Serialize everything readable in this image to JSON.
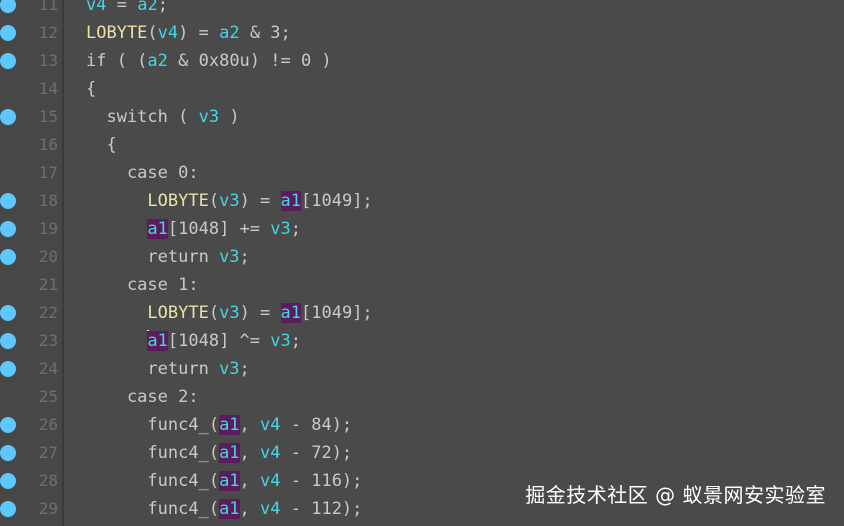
{
  "watermark": "掘金技术社区 @ 蚁景网安实验室",
  "colors": {
    "background": "#4a4a4a",
    "gutter": "#474747",
    "breakpoint": "#5fc7ff",
    "variable": "#43d6e6",
    "function": "#e9e3a6",
    "highlight_bg": "#5a1c5a",
    "text": "#c9c9c9"
  },
  "lines": [
    {
      "num": "11",
      "bp": true,
      "tokens": [
        {
          "t": "v4",
          "c": "var"
        },
        {
          "t": " = ",
          "c": "plain"
        },
        {
          "t": "a2",
          "c": "var"
        },
        {
          "t": ";",
          "c": "plain"
        }
      ]
    },
    {
      "num": "12",
      "bp": true,
      "tokens": [
        {
          "t": "LOBYTE",
          "c": "fn"
        },
        {
          "t": "(",
          "c": "plain"
        },
        {
          "t": "v4",
          "c": "var"
        },
        {
          "t": ") = ",
          "c": "plain"
        },
        {
          "t": "a2",
          "c": "var"
        },
        {
          "t": " & 3;",
          "c": "plain"
        }
      ]
    },
    {
      "num": "13",
      "bp": true,
      "tokens": [
        {
          "t": "if ( (",
          "c": "plain"
        },
        {
          "t": "a2",
          "c": "var"
        },
        {
          "t": " & 0x80u) != 0 )",
          "c": "plain"
        }
      ]
    },
    {
      "num": "14",
      "bp": false,
      "tokens": [
        {
          "t": "{",
          "c": "plain"
        }
      ]
    },
    {
      "num": "15",
      "bp": true,
      "tokens": [
        {
          "t": "  switch ( ",
          "c": "plain"
        },
        {
          "t": "v3",
          "c": "var"
        },
        {
          "t": " )",
          "c": "plain"
        }
      ]
    },
    {
      "num": "16",
      "bp": false,
      "tokens": [
        {
          "t": "  {",
          "c": "plain"
        }
      ]
    },
    {
      "num": "17",
      "bp": false,
      "tokens": [
        {
          "t": "    case 0:",
          "c": "plain"
        }
      ]
    },
    {
      "num": "18",
      "bp": true,
      "tokens": [
        {
          "t": "      ",
          "c": "plain"
        },
        {
          "t": "LOBYTE",
          "c": "fn"
        },
        {
          "t": "(",
          "c": "plain"
        },
        {
          "t": "v3",
          "c": "var"
        },
        {
          "t": ") = ",
          "c": "plain"
        },
        {
          "t": "a1",
          "c": "hl"
        },
        {
          "t": "[1049];",
          "c": "plain"
        }
      ]
    },
    {
      "num": "19",
      "bp": true,
      "tokens": [
        {
          "t": "      ",
          "c": "plain"
        },
        {
          "t": "a1",
          "c": "hl"
        },
        {
          "t": "[1048] += ",
          "c": "plain"
        },
        {
          "t": "v3",
          "c": "var"
        },
        {
          "t": ";",
          "c": "plain"
        }
      ]
    },
    {
      "num": "20",
      "bp": true,
      "tokens": [
        {
          "t": "      return ",
          "c": "plain"
        },
        {
          "t": "v3",
          "c": "var"
        },
        {
          "t": ";",
          "c": "plain"
        }
      ]
    },
    {
      "num": "21",
      "bp": false,
      "tokens": [
        {
          "t": "    case 1:",
          "c": "plain"
        }
      ]
    },
    {
      "num": "22",
      "bp": true,
      "tokens": [
        {
          "t": "      ",
          "c": "plain"
        },
        {
          "t": "LOBYTE",
          "c": "fn"
        },
        {
          "t": "(",
          "c": "plain"
        },
        {
          "t": "v3",
          "c": "var"
        },
        {
          "t": ") = ",
          "c": "plain"
        },
        {
          "t": "a1",
          "c": "hl"
        },
        {
          "t": "[1049];",
          "c": "plain"
        }
      ]
    },
    {
      "num": "23",
      "bp": true,
      "tokens": [
        {
          "t": "      ",
          "c": "plain"
        },
        {
          "t": "a1",
          "c": "hl",
          "caret": true
        },
        {
          "t": "[1048] ^= ",
          "c": "plain"
        },
        {
          "t": "v3",
          "c": "var"
        },
        {
          "t": ";",
          "c": "plain"
        }
      ]
    },
    {
      "num": "24",
      "bp": true,
      "tokens": [
        {
          "t": "      return ",
          "c": "plain"
        },
        {
          "t": "v3",
          "c": "var"
        },
        {
          "t": ";",
          "c": "plain"
        }
      ]
    },
    {
      "num": "25",
      "bp": false,
      "tokens": [
        {
          "t": "    case 2:",
          "c": "plain"
        }
      ]
    },
    {
      "num": "26",
      "bp": true,
      "tokens": [
        {
          "t": "      func4_(",
          "c": "plain"
        },
        {
          "t": "a1",
          "c": "hl"
        },
        {
          "t": ", ",
          "c": "plain"
        },
        {
          "t": "v4",
          "c": "var"
        },
        {
          "t": " - 84);",
          "c": "plain"
        }
      ]
    },
    {
      "num": "27",
      "bp": true,
      "tokens": [
        {
          "t": "      func4_(",
          "c": "plain"
        },
        {
          "t": "a1",
          "c": "hl"
        },
        {
          "t": ", ",
          "c": "plain"
        },
        {
          "t": "v4",
          "c": "var"
        },
        {
          "t": " - 72);",
          "c": "plain"
        }
      ]
    },
    {
      "num": "28",
      "bp": true,
      "tokens": [
        {
          "t": "      func4_(",
          "c": "plain"
        },
        {
          "t": "a1",
          "c": "hl"
        },
        {
          "t": ", ",
          "c": "plain"
        },
        {
          "t": "v4",
          "c": "var"
        },
        {
          "t": " - 116);",
          "c": "plain"
        }
      ]
    },
    {
      "num": "29",
      "bp": true,
      "tokens": [
        {
          "t": "      func4_(",
          "c": "plain"
        },
        {
          "t": "a1",
          "c": "hl"
        },
        {
          "t": ", ",
          "c": "plain"
        },
        {
          "t": "v4",
          "c": "var"
        },
        {
          "t": " - 112);",
          "c": "plain"
        }
      ]
    }
  ]
}
